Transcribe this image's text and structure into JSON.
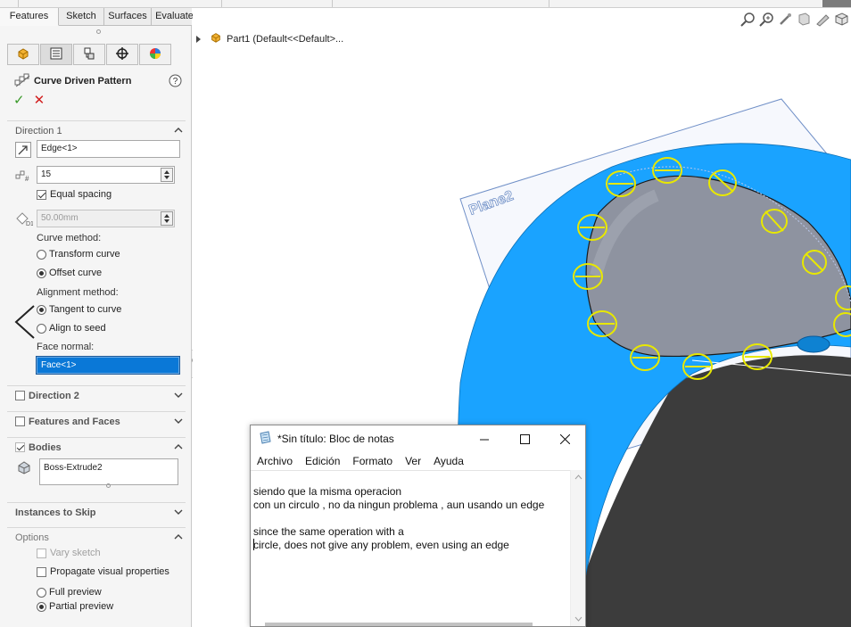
{
  "tabs": [
    "Features",
    "Sketch",
    "Surfaces",
    "Evaluate"
  ],
  "property_manager": {
    "title": "Curve Driven Pattern",
    "ok": "✓",
    "cancel": "✕",
    "direction1": {
      "header": "Direction 1",
      "edge_field": "Edge<1>",
      "instances": "15",
      "equal_spacing_label": "Equal spacing",
      "equal_spacing_checked": true,
      "spacing": "50.00mm",
      "curve_method_label": "Curve method:",
      "transform_curve": "Transform curve",
      "offset_curve": "Offset curve",
      "alignment_method_label": "Alignment method:",
      "tangent_to_curve": "Tangent to curve",
      "align_to_seed": "Align to seed",
      "face_normal_label": "Face normal:",
      "face_field": "Face<1>"
    },
    "direction2": {
      "header": "Direction 2"
    },
    "features_and_faces": {
      "header": "Features and Faces"
    },
    "bodies": {
      "header": "Bodies",
      "body": "Boss-Extrude2"
    },
    "instances_to_skip": {
      "header": "Instances to Skip"
    },
    "options": {
      "header": "Options",
      "vary_sketch": "Vary sketch",
      "propagate": "Propagate visual properties",
      "full_preview": "Full preview",
      "partial_preview": "Partial preview"
    }
  },
  "tree": {
    "label": "Part1  (Default<<Default>..."
  },
  "viewport": {
    "plane_label": "Plane2",
    "body_color": "#1aa3ff",
    "preview_color": "#e8e800"
  },
  "notepad": {
    "title": "*Sin título: Bloc de notas",
    "menu": [
      "Archivo",
      "Edición",
      "Formato",
      "Ver",
      "Ayuda"
    ],
    "line1": "siendo que la misma operacion",
    "line2": "con un circulo , no da ningun problema , aun usando un edge",
    "line3": "",
    "line4": "since the same operation with a",
    "line5": "circle, does not give any problem, even using an edge"
  }
}
